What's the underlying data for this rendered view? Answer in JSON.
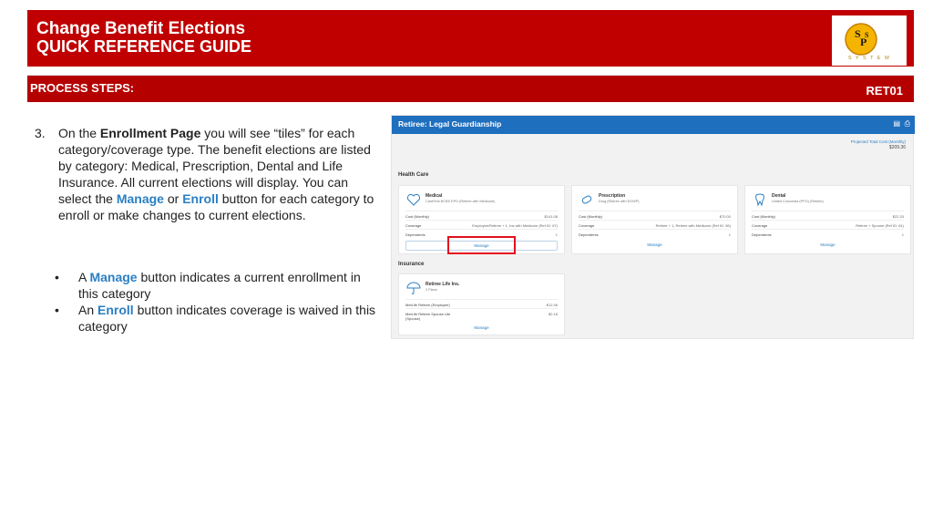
{
  "header": {
    "title_line1": "Change Benefit Elections",
    "title_line2": "QUICK REFERENCE GUIDE",
    "logo_letters": "SPS",
    "logo_caption": "S Y S T E M"
  },
  "subheader": {
    "process_steps": "PROCESS STEPS:",
    "code": "RET01"
  },
  "step": {
    "number": "3.",
    "t1": "On the ",
    "t2": "Enrollment Page",
    "t3": " you will see “tiles” for each category/coverage type.  The benefit elections are listed by category: Medical, Prescription, Dental and Life Insurance.  All current elections will display.  You can select the ",
    "t4": "Manage",
    "t5": " or ",
    "t6": "Enroll",
    "t7": " button for each category to enroll or make changes to current elections."
  },
  "bullets": [
    {
      "dot": "•",
      "pre": "A ",
      "em": "Manage",
      "post": " button indicates a current enrollment in this category"
    },
    {
      "dot": "•",
      "pre": "An ",
      "em": "Enroll",
      "post": " button indicates coverage is waived in this category"
    }
  ],
  "screenshot": {
    "bar_title": "Retiree: Legal Guardianship",
    "cost_label": "Projected Total Cost (Monthly)",
    "cost_value": "$209.36",
    "health_care": "Health Care",
    "insurance": "Insurance",
    "tiles": [
      {
        "name": "Medical",
        "sub": "CareFirst BCBS EPO (Retiree with Medicare)",
        "cost_k": "Cost (Monthly)",
        "cost_v": "$141.08",
        "cov_k": "Coverage",
        "cov_v": "Employee/Retiree + 1, Ins with Medicare (Ref ID: 67)",
        "dep_k": "Dependents",
        "dep_v": "1",
        "button": "Manage",
        "icon": "heart-icon"
      },
      {
        "name": "Prescription",
        "sub": "Drug (Retiree with EGWP)",
        "cost_k": "Cost (Monthly)",
        "cost_v": "$70.00",
        "cov_k": "Coverage",
        "cov_v": "Retiree + 1, Retiree with Medicare (Ref ID: 56)",
        "dep_k": "Dependents",
        "dep_v": "1",
        "button": "Manage",
        "icon": "pill-icon"
      },
      {
        "name": "Dental",
        "sub": "United Concordia (PPO) (Retiree)",
        "cost_k": "Cost (Monthly)",
        "cost_v": "$22.33",
        "cov_k": "Coverage",
        "cov_v": "Retiree + Spouse (Ref ID: 61)",
        "dep_k": "Dependents",
        "dep_v": "1",
        "button": "Manage",
        "icon": "tooth-icon"
      }
    ],
    "life": {
      "name": "Retiree Life Ins.",
      "sub": "2 Plans",
      "r1_k": "MetLife Retiree (Employee)",
      "r1_v": "$12.46",
      "r2_k": "MetLife Retiree Spouse Life (Spouse)",
      "r2_v": "$2.18",
      "button": "Manage",
      "icon": "umbrella-icon"
    }
  }
}
